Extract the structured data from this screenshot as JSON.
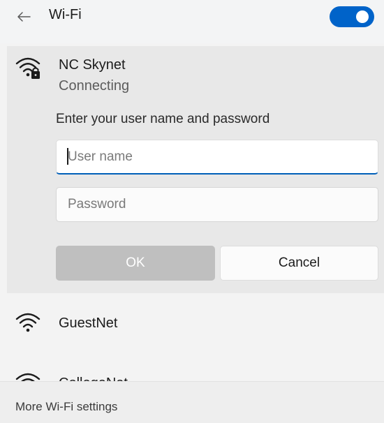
{
  "header": {
    "title": "Wi-Fi",
    "back_icon": "arrow-left-icon",
    "wifi_enabled": true,
    "accent_color": "#0063c9"
  },
  "connecting_network": {
    "name": "NC Skynet",
    "status": "Connecting",
    "icon": "wifi-secured-icon",
    "prompt": "Enter your user name and password",
    "username": {
      "value": "",
      "placeholder": "User name"
    },
    "password": {
      "value": "",
      "placeholder": "Password"
    },
    "ok_label": "OK",
    "cancel_label": "Cancel"
  },
  "networks": [
    {
      "name": "GuestNet",
      "icon": "wifi-icon"
    },
    {
      "name": "CollegeNet",
      "icon": "wifi-icon"
    }
  ],
  "footer": {
    "link_label": "More Wi-Fi settings"
  }
}
